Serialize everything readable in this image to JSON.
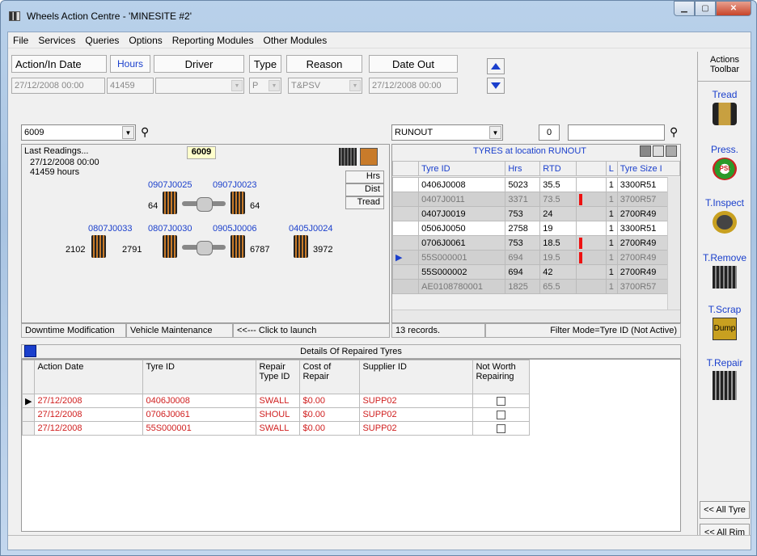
{
  "window": {
    "title": "Wheels Action Centre - 'MINESITE #2'"
  },
  "menu": [
    "File",
    "Services",
    "Queries",
    "Options",
    "Reporting Modules",
    "Other Modules"
  ],
  "header": {
    "action_date": "Action/In Date",
    "hours": "Hours",
    "driver": "Driver",
    "type": "Type",
    "reason": "Reason",
    "date_out": "Date Out"
  },
  "fields": {
    "action_date": "27/12/2008 00:00",
    "hours": "41459",
    "driver": "",
    "type": "P",
    "reason": "T&PSV",
    "date_out": "27/12/2008 00:00"
  },
  "vehicle": {
    "combo": "6009",
    "last_readings": "Last Readings...",
    "badge": "6009",
    "reading_date": "27/12/2008 00:00",
    "reading_hours": "41459 hours",
    "buttons": [
      "Hrs",
      "Dist",
      "Tread"
    ],
    "tyres_top": [
      {
        "id": "0907J0025",
        "val": "64"
      },
      {
        "id": "0907J0023",
        "val": "64"
      }
    ],
    "tyres_bottom": [
      {
        "id": "0807J0033",
        "val": "2102"
      },
      {
        "id": "0807J0030",
        "val": "2791"
      },
      {
        "id": "0905J0006",
        "val": "6787"
      },
      {
        "id": "0405J0024",
        "val": "3972"
      }
    ]
  },
  "links": {
    "downtime": "Downtime Modification",
    "maintenance": "Vehicle Maintenance",
    "launch": "<<--- Click to launch"
  },
  "location": {
    "combo": "RUNOUT",
    "count_btn": "0",
    "search": "",
    "title": "TYRES at location RUNOUT",
    "columns": [
      "Tyre ID",
      "Hrs",
      "RTD",
      "L",
      "Tyre Size I"
    ],
    "rows": [
      {
        "id": "0406J0008",
        "hrs": "5023",
        "rtd": "35.5",
        "l": "1",
        "size": "3300R51",
        "style": "w",
        "red": false,
        "cur": false
      },
      {
        "id": "0407J0011",
        "hrs": "3371",
        "rtd": "73.5",
        "l": "1",
        "size": "3700R57",
        "style": "sel",
        "red": true,
        "cur": false
      },
      {
        "id": "0407J0019",
        "hrs": "753",
        "rtd": "24",
        "l": "1",
        "size": "2700R49",
        "style": "dim",
        "red": false,
        "cur": false
      },
      {
        "id": "0506J0050",
        "hrs": "2758",
        "rtd": "19",
        "l": "1",
        "size": "3300R51",
        "style": "w",
        "red": false,
        "cur": false
      },
      {
        "id": "0706J0061",
        "hrs": "753",
        "rtd": "18.5",
        "l": "1",
        "size": "2700R49",
        "style": "dim",
        "red": true,
        "cur": false
      },
      {
        "id": "55S000001",
        "hrs": "694",
        "rtd": "19.5",
        "l": "1",
        "size": "2700R49",
        "style": "sel",
        "red": true,
        "cur": true
      },
      {
        "id": "55S000002",
        "hrs": "694",
        "rtd": "42",
        "l": "1",
        "size": "2700R49",
        "style": "dim",
        "red": false,
        "cur": false
      },
      {
        "id": "AE0108780001",
        "hrs": "1825",
        "rtd": "65.5",
        "l": "1",
        "size": "3700R57",
        "style": "sel",
        "red": false,
        "cur": false
      }
    ],
    "records": "13 records.",
    "filter": "Filter Mode=Tyre ID (Not Active)"
  },
  "repaired": {
    "title": "Details Of Repaired Tyres",
    "columns": [
      "Action Date",
      "Tyre ID",
      "Repair Type ID",
      "Cost of Repair",
      "Supplier ID",
      "Not Worth Repairing"
    ],
    "rows": [
      {
        "date": "27/12/2008",
        "tyre": "0406J0008",
        "type": "SWALL",
        "cost": "$0.00",
        "supplier": "SUPP02"
      },
      {
        "date": "27/12/2008",
        "tyre": "0706J0061",
        "type": "SHOUL",
        "cost": "$0.00",
        "supplier": "SUPP02"
      },
      {
        "date": "27/12/2008",
        "tyre": "55S000001",
        "type": "SWALL",
        "cost": "$0.00",
        "supplier": "SUPP02"
      }
    ]
  },
  "toolbar": {
    "title1": "Actions",
    "title2": "Toolbar",
    "items": [
      "Tread",
      "Press.",
      "T.Inspect",
      "T.Remove",
      "T.Scrap",
      "T.Repair"
    ],
    "dump": "Dump",
    "psi": "PSI",
    "all_tyre": "<< All Tyre",
    "all_rim": "<< All Rim"
  },
  "colors": {
    "link_blue": "#1a3fcc",
    "repair_red": "#d02020",
    "flag_red": "#e11111"
  }
}
